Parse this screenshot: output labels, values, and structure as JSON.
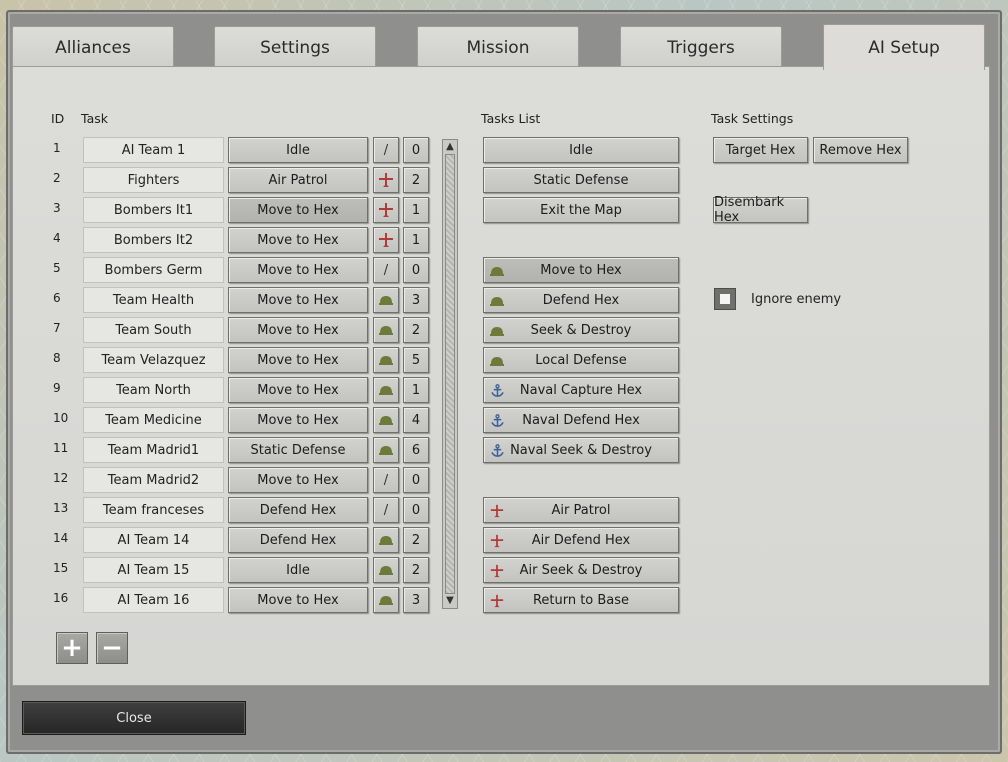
{
  "tabs": [
    "Alliances",
    "Settings",
    "Mission",
    "Triggers",
    "AI Setup"
  ],
  "headers": {
    "id": "ID",
    "task": "Task",
    "tasks_list": "Tasks List",
    "task_settings": "Task Settings"
  },
  "teams": [
    {
      "id": "1",
      "name": "AI Team 1",
      "task": "Idle",
      "icon": "slash",
      "count": "0"
    },
    {
      "id": "2",
      "name": "Fighters",
      "task": "Air Patrol",
      "icon": "plane",
      "count": "2"
    },
    {
      "id": "3",
      "name": "Bombers It1",
      "task": "Move to Hex",
      "icon": "plane",
      "count": "1"
    },
    {
      "id": "4",
      "name": "Bombers It2",
      "task": "Move to Hex",
      "icon": "plane",
      "count": "1"
    },
    {
      "id": "5",
      "name": "Bombers Germ",
      "task": "Move to Hex",
      "icon": "slash",
      "count": "0"
    },
    {
      "id": "6",
      "name": "Team Health",
      "task": "Move to Hex",
      "icon": "helmet",
      "count": "3"
    },
    {
      "id": "7",
      "name": "Team South",
      "task": "Move to Hex",
      "icon": "helmet",
      "count": "2"
    },
    {
      "id": "8",
      "name": "Team Velazquez",
      "task": "Move to Hex",
      "icon": "helmet",
      "count": "5"
    },
    {
      "id": "9",
      "name": "Team North",
      "task": "Move to Hex",
      "icon": "helmet",
      "count": "1"
    },
    {
      "id": "10",
      "name": "Team Medicine",
      "task": "Move to Hex",
      "icon": "helmet",
      "count": "4"
    },
    {
      "id": "11",
      "name": "Team Madrid1",
      "task": "Static Defense",
      "icon": "helmet",
      "count": "6"
    },
    {
      "id": "12",
      "name": "Team Madrid2",
      "task": "Move to Hex",
      "icon": "slash",
      "count": "0"
    },
    {
      "id": "13",
      "name": "Team franceses",
      "task": "Defend Hex",
      "icon": "slash",
      "count": "0"
    },
    {
      "id": "14",
      "name": "AI Team 14",
      "task": "Defend Hex",
      "icon": "helmet",
      "count": "2"
    },
    {
      "id": "15",
      "name": "AI Team 15",
      "task": "Idle",
      "icon": "helmet",
      "count": "2"
    },
    {
      "id": "16",
      "name": "AI Team 16",
      "task": "Move to Hex",
      "icon": "helmet",
      "count": "3"
    }
  ],
  "selected_team_index": 2,
  "slash_glyph": "/",
  "tasks_list": [
    {
      "label": "Idle",
      "icon": "none",
      "slot": 0
    },
    {
      "label": "Static Defense",
      "icon": "none",
      "slot": 1
    },
    {
      "label": "Exit the Map",
      "icon": "none",
      "slot": 2
    },
    {
      "label": "Move to Hex",
      "icon": "helmet",
      "slot": 4
    },
    {
      "label": "Defend Hex",
      "icon": "helmet",
      "slot": 5
    },
    {
      "label": "Seek & Destroy",
      "icon": "helmet",
      "slot": 6
    },
    {
      "label": "Local Defense",
      "icon": "helmet",
      "slot": 7
    },
    {
      "label": "Naval Capture Hex",
      "icon": "anchor",
      "slot": 8
    },
    {
      "label": "Naval Defend Hex",
      "icon": "anchor",
      "slot": 9
    },
    {
      "label": "Naval Seek & Destroy",
      "icon": "anchor",
      "slot": 10
    },
    {
      "label": "Air Patrol",
      "icon": "plane",
      "slot": 12
    },
    {
      "label": "Air Defend Hex",
      "icon": "plane",
      "slot": 13
    },
    {
      "label": "Air Seek & Destroy",
      "icon": "plane",
      "slot": 14
    },
    {
      "label": "Return to Base",
      "icon": "plane",
      "slot": 15
    }
  ],
  "selected_tasklist_index": 3,
  "task_settings": {
    "target_hex": "Target Hex",
    "remove_hex": "Remove Hex",
    "disembark_hex": "Disembark Hex",
    "ignore_enemy": "Ignore enemy"
  },
  "add_glyph": "+",
  "remove_glyph": "−",
  "close_label": "Close",
  "colors": {
    "plane": "#b23a3a",
    "helmet": "#6e7a3a",
    "anchor": "#3c5f9a"
  }
}
